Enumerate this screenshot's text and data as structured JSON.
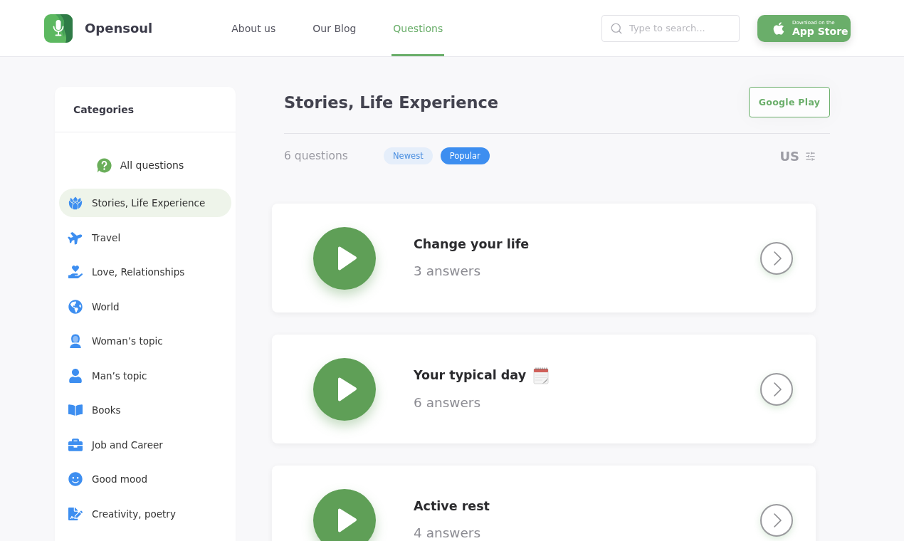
{
  "header": {
    "brand": "Opensoul",
    "nav": [
      {
        "label": "About us",
        "selected": false
      },
      {
        "label": "Our Blog",
        "selected": false
      },
      {
        "label": "Questions",
        "selected": true
      }
    ],
    "search": {
      "placeholder": "Type to search..."
    },
    "app_store": {
      "caption": "Download on the",
      "label": "App Store"
    }
  },
  "sidebar": {
    "title": "Categories",
    "all_item": {
      "label": "All questions",
      "selected": false
    },
    "items": [
      {
        "label": "Stories, Life Experience",
        "selected": true
      },
      {
        "label": "Travel",
        "selected": false
      },
      {
        "label": "Love, Relationships",
        "selected": false
      },
      {
        "label": "World",
        "selected": false
      },
      {
        "label": "Woman’s topic",
        "selected": false
      },
      {
        "label": "Man’s topic",
        "selected": false
      },
      {
        "label": "Books",
        "selected": false
      },
      {
        "label": "Job and Career",
        "selected": false
      },
      {
        "label": "Good mood",
        "selected": false
      },
      {
        "label": "Creativity, poetry",
        "selected": false
      }
    ]
  },
  "main": {
    "title": "Stories, Life Experience",
    "google_play": "Google Play",
    "count": "6 questions",
    "sorts": [
      {
        "label": "Newest",
        "selected": false
      },
      {
        "label": "Popular",
        "selected": true
      }
    ],
    "region": "US",
    "questions": [
      {
        "title": "Change your life",
        "answers": "3 answers",
        "emoji": false
      },
      {
        "title": "Your typical day",
        "answers": "6 answers",
        "emoji": true
      },
      {
        "title": "Active rest",
        "answers": "4 answers",
        "emoji": false
      }
    ]
  }
}
